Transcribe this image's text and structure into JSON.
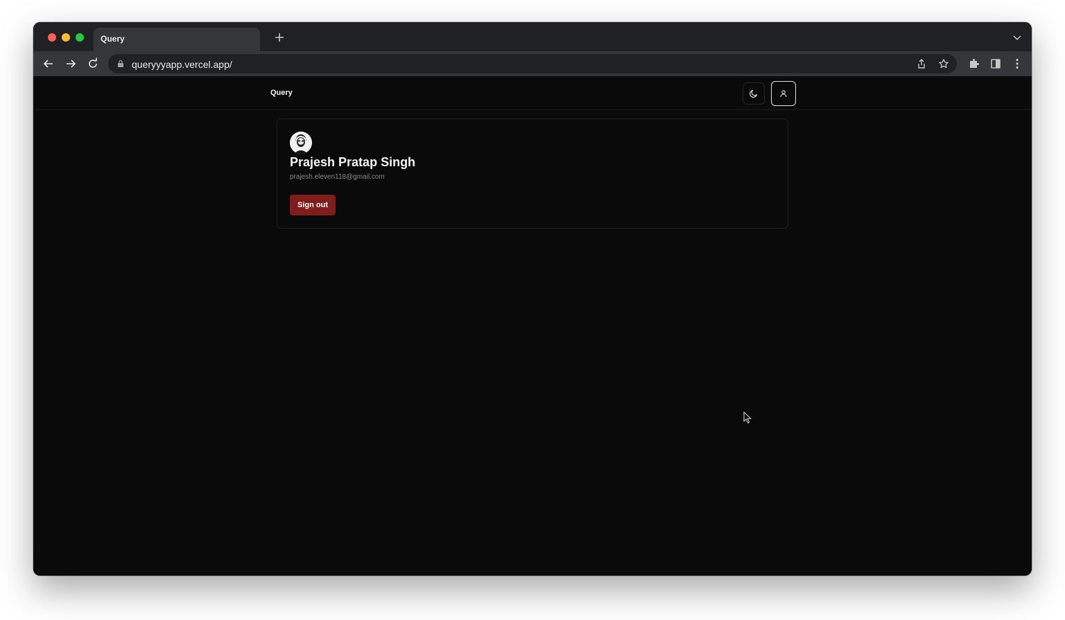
{
  "browser": {
    "tab_title": "Query",
    "new_tab_icon": "plus-icon",
    "url": "queryyyapp.vercel.app/",
    "controls": [
      "back-icon",
      "forward-icon",
      "reload-icon"
    ],
    "omnibox_icons": [
      "share-icon",
      "star-icon"
    ],
    "toolbar_icons": [
      "puzzle-icon",
      "side-panel-icon",
      "more-vert-icon"
    ]
  },
  "app": {
    "brand": "Query",
    "theme_toggle_icon": "moon-icon",
    "profile_icon": "user-icon"
  },
  "profile": {
    "name": "Prajesh Pratap Singh",
    "email": "prajesh.eleven118@gmail.com",
    "signout_label": "Sign out"
  },
  "colors": {
    "page_bg": "#0a0a0a",
    "signout_bg": "#7f1d1d",
    "border": "#1f1f1f"
  }
}
